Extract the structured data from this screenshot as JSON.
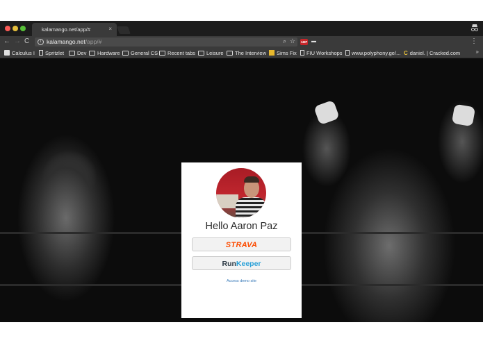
{
  "tab": {
    "title": "kalamango.net/app/#",
    "close": "×"
  },
  "toolbar": {
    "back": "←",
    "forward": "→",
    "reload": "C",
    "url_host": "kalamango.net",
    "url_path": "/app/#",
    "zoom_glyph": "⌕",
    "star_glyph": "☆",
    "abp_label": "ABP",
    "menu_glyph": "⋮"
  },
  "bookmarks": {
    "items": [
      {
        "label": "Calculus I",
        "icon": "bookmark-page-icon"
      },
      {
        "label": "Spritzlet",
        "icon": "page-icon"
      },
      {
        "label": "Dev",
        "icon": "folder-icon"
      },
      {
        "label": "Hardware",
        "icon": "folder-icon"
      },
      {
        "label": "General CS",
        "icon": "folder-icon"
      },
      {
        "label": "Recent tabs",
        "icon": "folder-icon"
      },
      {
        "label": "Leisure",
        "icon": "folder-icon"
      },
      {
        "label": "The Interview",
        "icon": "folder-icon"
      },
      {
        "label": "Sims Fix",
        "icon": "sims-icon"
      },
      {
        "label": "FIU Workshops",
        "icon": "page-icon"
      },
      {
        "label": "www.polyphony.ge/...",
        "icon": "page-icon"
      },
      {
        "label": "daniel. | Cracked.com",
        "icon": "cracked-icon"
      }
    ],
    "more": "»"
  },
  "card": {
    "greeting": "Hello Aaron Paz",
    "strava_label": "STRAVA",
    "runkeeper_run": "Run",
    "runkeeper_keeper": "Keeper",
    "demo_link": "Access demo site"
  },
  "colors": {
    "strava": "#fc4c02",
    "runkeeper_blue": "#2ba1d8",
    "link": "#3477b7"
  }
}
